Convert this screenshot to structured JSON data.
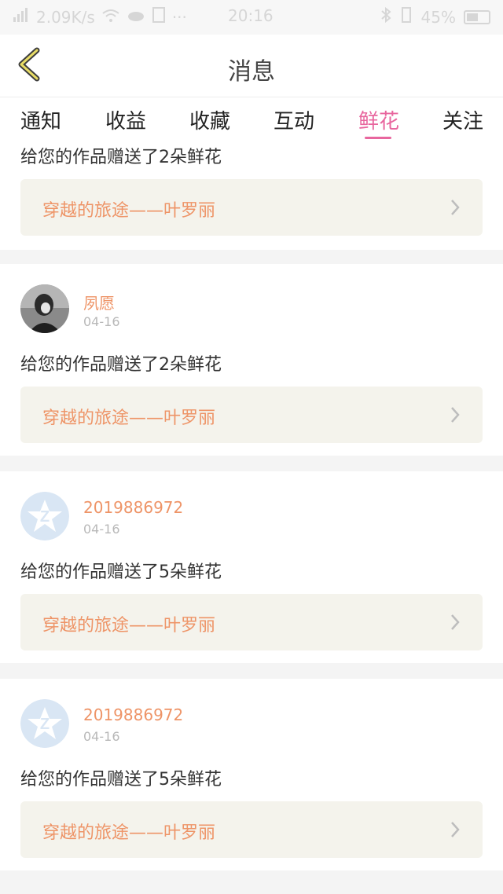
{
  "status_bar": {
    "net_speed": "2.09K/s",
    "time": "20:16",
    "battery": "45%"
  },
  "header": {
    "title": "消息"
  },
  "tabs": [
    {
      "label": "通知"
    },
    {
      "label": "收益"
    },
    {
      "label": "收藏"
    },
    {
      "label": "互动"
    },
    {
      "label": "鲜花"
    },
    {
      "label": "关注"
    }
  ],
  "active_tab": "鲜花",
  "messages": [
    {
      "user": "",
      "date": "",
      "text": "给您的作品赠送了2朵鲜花",
      "work": "穿越的旅途——叶罗丽"
    },
    {
      "user": "夙愿",
      "date": "04-16",
      "text": "给您的作品赠送了2朵鲜花",
      "work": "穿越的旅途——叶罗丽"
    },
    {
      "user": "2019886972",
      "date": "04-16",
      "text": "给您的作品赠送了5朵鲜花",
      "work": "穿越的旅途——叶罗丽"
    },
    {
      "user": "2019886972",
      "date": "04-16",
      "text": "给您的作品赠送了5朵鲜花",
      "work": "穿越的旅途——叶罗丽"
    }
  ],
  "colors": {
    "accent_pink": "#e8669e",
    "name_orange": "#ee9467",
    "link_bg": "#f4f3ec"
  }
}
